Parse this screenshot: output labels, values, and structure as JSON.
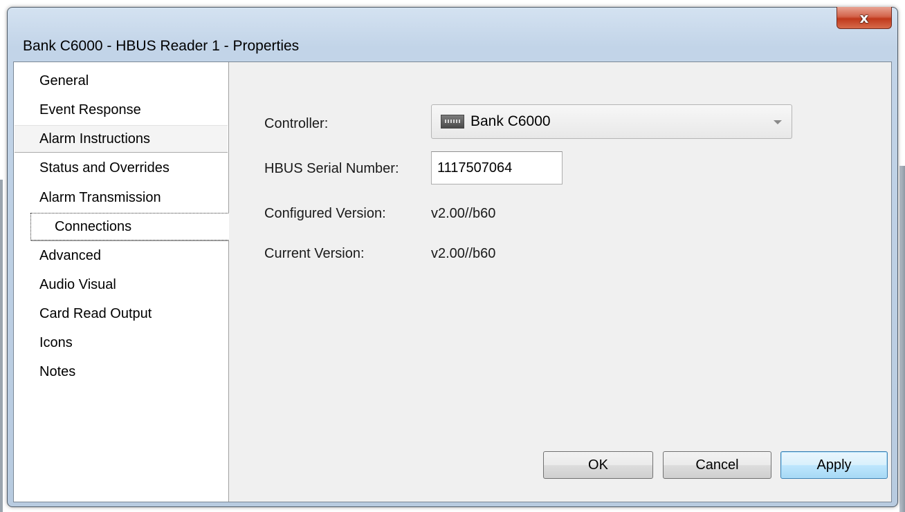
{
  "window": {
    "title": "Bank C6000 - HBUS Reader 1 - Properties",
    "close_glyph": "x"
  },
  "sidebar": {
    "items": [
      {
        "label": "General"
      },
      {
        "label": "Event Response"
      },
      {
        "label": "Alarm Instructions"
      },
      {
        "label": "Status and Overrides"
      },
      {
        "label": "Alarm Transmission"
      },
      {
        "label": "Connections"
      },
      {
        "label": "Advanced"
      },
      {
        "label": "Audio Visual"
      },
      {
        "label": "Card Read Output"
      },
      {
        "label": "Icons"
      },
      {
        "label": "Notes"
      }
    ],
    "selected": "Connections",
    "hovered": "Alarm Instructions"
  },
  "form": {
    "controller_label": "Controller:",
    "controller_value": "Bank C6000",
    "controller_icon": "controller-device-icon",
    "serial_label": "HBUS Serial Number:",
    "serial_value": "1117507064",
    "configured_version_label": "Configured Version:",
    "configured_version_value": "v2.00//b60",
    "current_version_label": "Current Version:",
    "current_version_value": "v2.00//b60"
  },
  "buttons": {
    "ok": "OK",
    "cancel": "Cancel",
    "apply": "Apply"
  }
}
